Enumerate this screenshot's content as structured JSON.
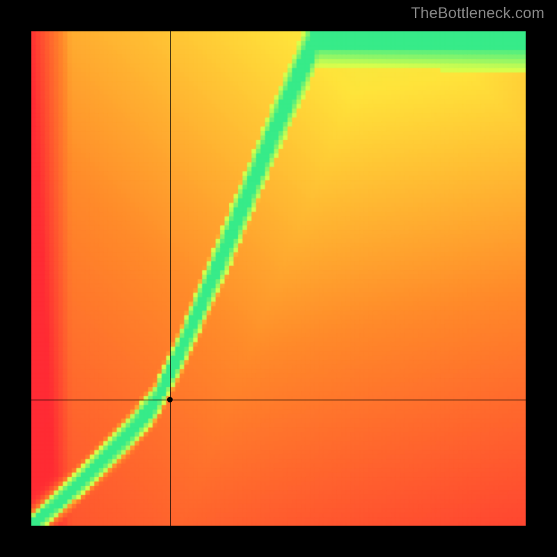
{
  "watermark": "TheBottleneck.com",
  "chart_data": {
    "type": "heatmap",
    "title": "",
    "xlabel": "",
    "ylabel": "",
    "xlim": [
      0,
      100
    ],
    "ylim": [
      0,
      100
    ],
    "grid": false,
    "legend": false,
    "palette_comment": "stops are 0=red, 0.5=yellow, 1=green; value is a 0..1 compatibility score",
    "palette": [
      {
        "t": 0.0,
        "color": "#ff2b34"
      },
      {
        "t": 0.35,
        "color": "#ff8a2a"
      },
      {
        "t": 0.6,
        "color": "#ffe43b"
      },
      {
        "t": 0.82,
        "color": "#d6ff4d"
      },
      {
        "t": 1.0,
        "color": "#18e796"
      }
    ],
    "ridge_comment": "green optimal ridge y = f(x); piecewise: near-linear y≈x up to x≈25, then steepens toward slope≈2.5",
    "ridge": [
      {
        "x": 0,
        "y": 0
      },
      {
        "x": 10,
        "y": 9
      },
      {
        "x": 20,
        "y": 19
      },
      {
        "x": 25,
        "y": 25
      },
      {
        "x": 30,
        "y": 35
      },
      {
        "x": 40,
        "y": 58
      },
      {
        "x": 50,
        "y": 82
      },
      {
        "x": 58,
        "y": 100
      }
    ],
    "ridge_halfwidth_comment": "half-width of green band in y-units as function of x",
    "ridge_halfwidth": [
      {
        "x": 0,
        "w": 2
      },
      {
        "x": 25,
        "w": 3
      },
      {
        "x": 40,
        "w": 5
      },
      {
        "x": 60,
        "w": 6
      },
      {
        "x": 100,
        "w": 7
      }
    ],
    "field_comment": "background warmth increases toward upper-right (orange-yellow) and cools toward to red on lower-right and left edges",
    "marker": {
      "x": 28,
      "y": 25.5
    },
    "crosshair": {
      "x": 28,
      "y": 25.5
    },
    "resolution": 110
  }
}
